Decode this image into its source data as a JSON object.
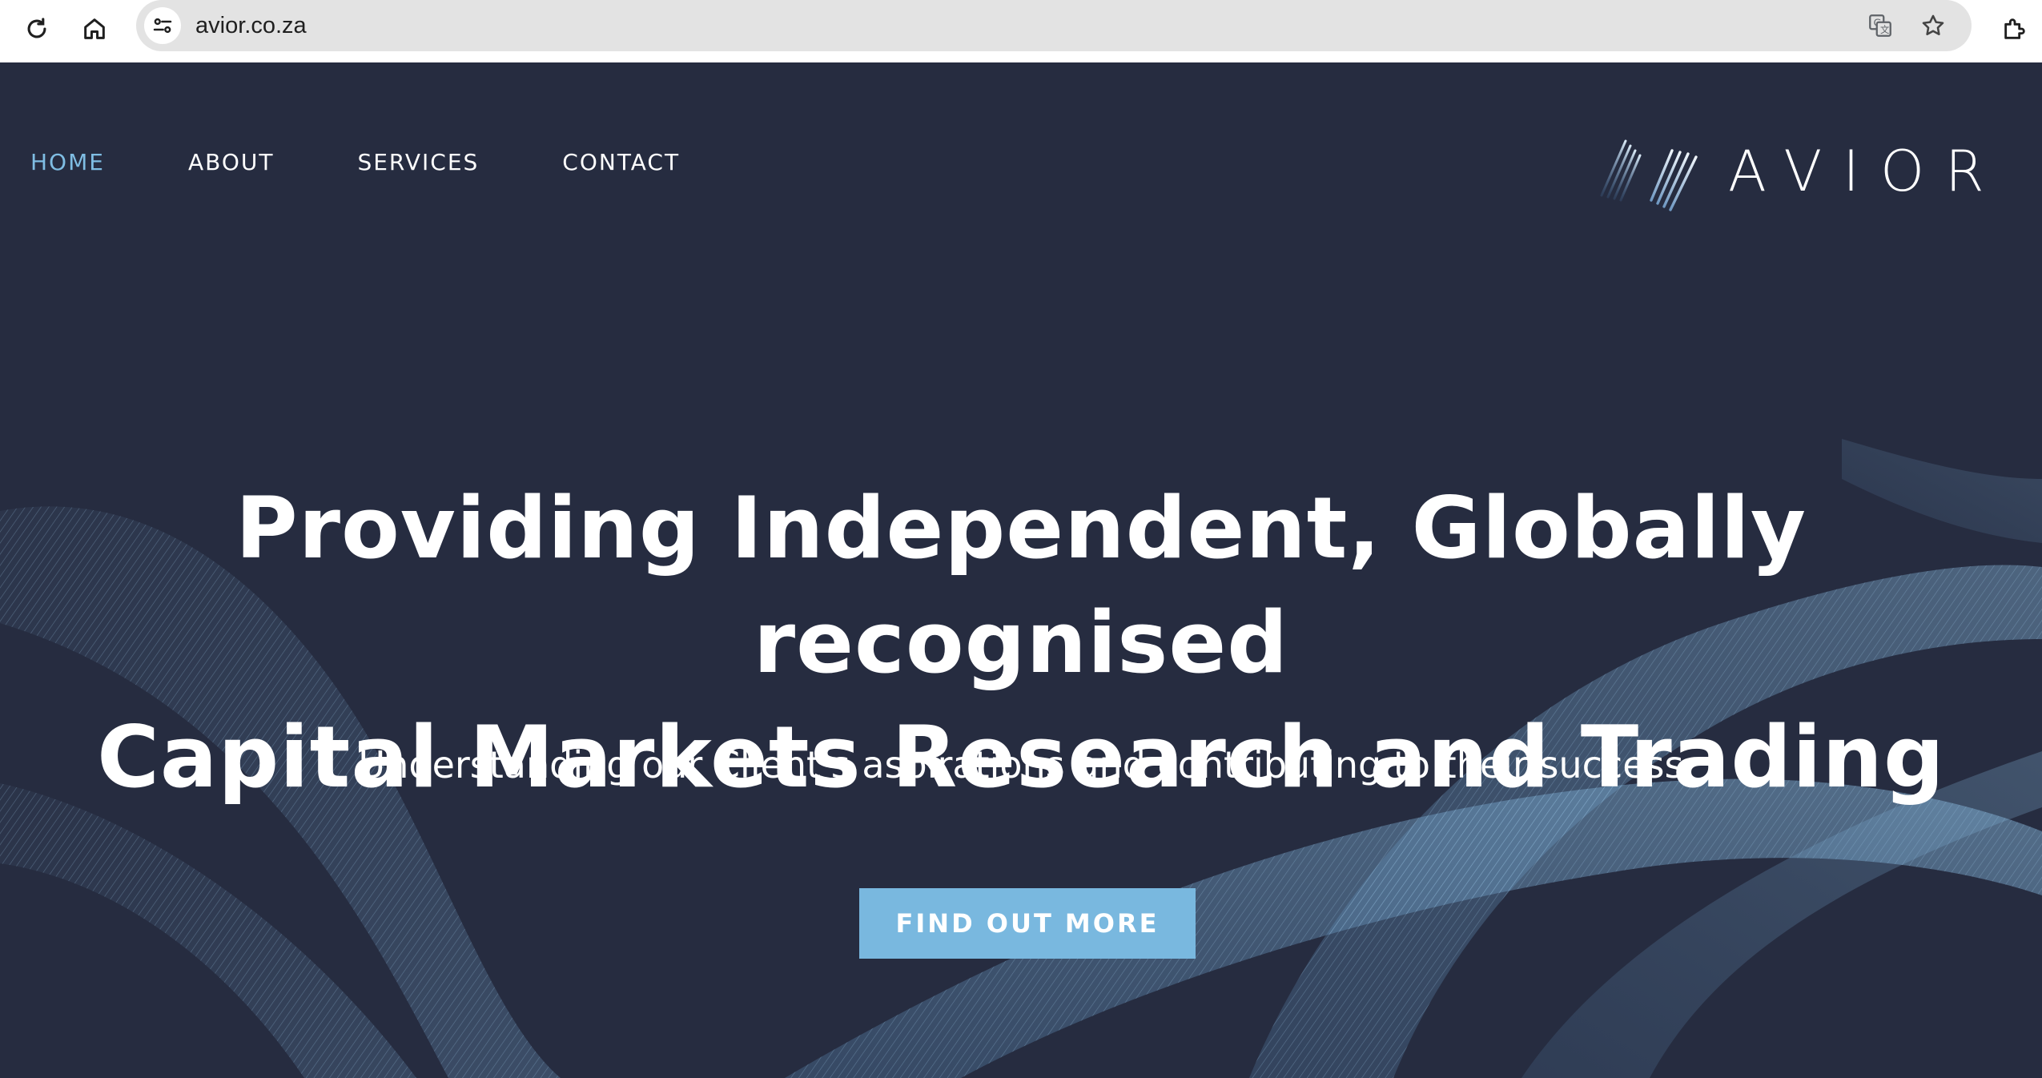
{
  "browser": {
    "url": "avior.co.za"
  },
  "nav": {
    "items": [
      {
        "label": "HOME",
        "active": true
      },
      {
        "label": "ABOUT",
        "active": false
      },
      {
        "label": "SERVICES",
        "active": false
      },
      {
        "label": "CONTACT",
        "active": false
      }
    ]
  },
  "logo": {
    "text": "AVIOR"
  },
  "hero": {
    "title_line1": "Providing Independent, Globally recognised",
    "title_line2": "Capital Markets Research and Trading",
    "subtitle": "Understanding our Client's aspirations and contributing to their success",
    "cta_label": "FIND OUT MORE"
  },
  "colors": {
    "background": "#262c40",
    "accent": "#79b8df",
    "nav_active": "#7fbde3",
    "text": "#ffffff"
  }
}
